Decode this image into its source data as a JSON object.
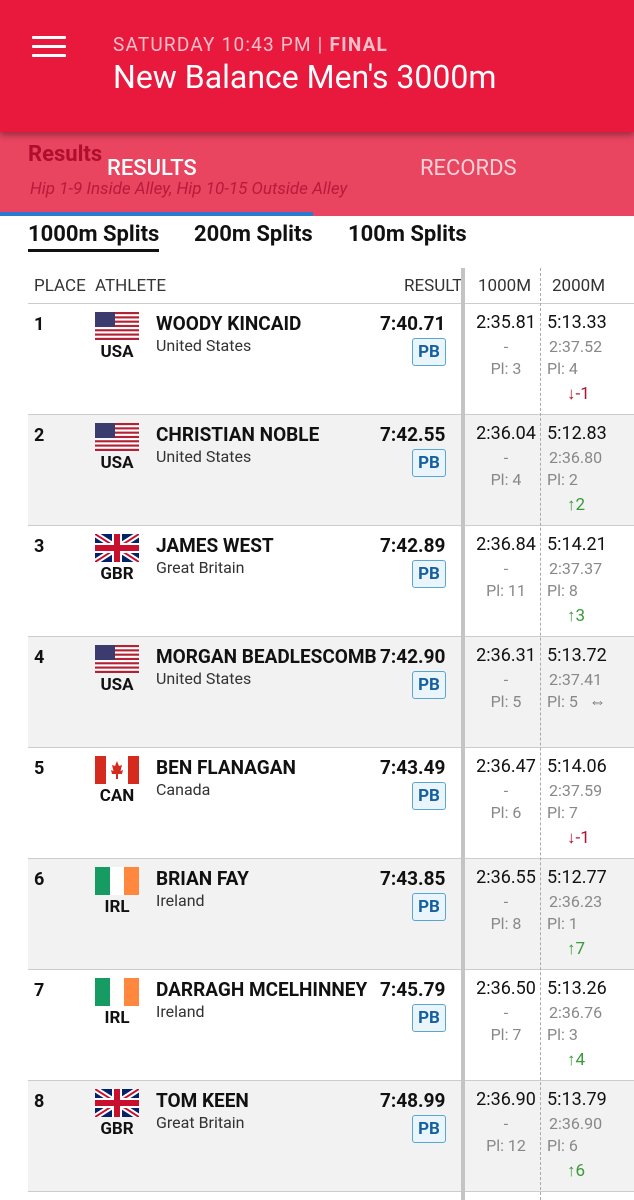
{
  "header": {
    "day_time": "SATURDAY 10:43 PM | ",
    "status": "FINAL",
    "title": "New Balance Men's 3000m"
  },
  "ghost": {
    "results": "Results",
    "note": "Hip 1-9 Inside Alley, Hip 10-15 Outside Alley"
  },
  "tabs": [
    "RESULTS",
    "RECORDS"
  ],
  "splits": [
    "1000m Splits",
    "200m Splits",
    "100m Splits"
  ],
  "columns": [
    "PLACE",
    "ATHLETE",
    "RESULT",
    "1000M",
    "2000M"
  ],
  "rows": [
    {
      "place": "1",
      "code": "USA",
      "name": "WOODY KINCAID",
      "country": "United States",
      "result": "7:40.71",
      "pb": "PB",
      "s1": "2:35.81",
      "s1d": "-",
      "s1p": "Pl: 3",
      "s2": "5:13.33",
      "s2d": "2:37.52",
      "s2p": "Pl: 4",
      "mv": "↓-1",
      "dir": "down"
    },
    {
      "place": "2",
      "code": "USA",
      "name": "CHRISTIAN NOBLE",
      "country": "United States",
      "result": "7:42.55",
      "pb": "PB",
      "s1": "2:36.04",
      "s1d": "-",
      "s1p": "Pl: 4",
      "s2": "5:12.83",
      "s2d": "2:36.80",
      "s2p": "Pl: 2",
      "mv": "↑2",
      "dir": "up"
    },
    {
      "place": "3",
      "code": "GBR",
      "name": "JAMES WEST",
      "country": "Great Britain",
      "result": "7:42.89",
      "pb": "PB",
      "s1": "2:36.84",
      "s1d": "-",
      "s1p": "Pl: 11",
      "s2": "5:14.21",
      "s2d": "2:37.37",
      "s2p": "Pl: 8",
      "mv": "↑3",
      "dir": "up"
    },
    {
      "place": "4",
      "code": "USA",
      "name": "MORGAN BEADLESCOMB",
      "country": "United States",
      "result": "7:42.90",
      "pb": "PB",
      "s1": "2:36.31",
      "s1d": "-",
      "s1p": "Pl: 5",
      "s2": "5:13.72",
      "s2d": "2:37.41",
      "s2p": "Pl: 5",
      "mv": "⇔",
      "dir": "same"
    },
    {
      "place": "5",
      "code": "CAN",
      "name": "BEN FLANAGAN",
      "country": "Canada",
      "result": "7:43.49",
      "pb": "PB",
      "s1": "2:36.47",
      "s1d": "-",
      "s1p": "Pl: 6",
      "s2": "5:14.06",
      "s2d": "2:37.59",
      "s2p": "Pl: 7",
      "mv": "↓-1",
      "dir": "down"
    },
    {
      "place": "6",
      "code": "IRL",
      "name": "BRIAN FAY",
      "country": "Ireland",
      "result": "7:43.85",
      "pb": "PB",
      "s1": "2:36.55",
      "s1d": "-",
      "s1p": "Pl: 8",
      "s2": "5:12.77",
      "s2d": "2:36.23",
      "s2p": "Pl: 1",
      "mv": "↑7",
      "dir": "up"
    },
    {
      "place": "7",
      "code": "IRL",
      "name": "DARRAGH MCELHINNEY",
      "country": "Ireland",
      "result": "7:45.79",
      "pb": "PB",
      "s1": "2:36.50",
      "s1d": "-",
      "s1p": "Pl: 7",
      "s2": "5:13.26",
      "s2d": "2:36.76",
      "s2p": "Pl: 3",
      "mv": "↑4",
      "dir": "up"
    },
    {
      "place": "8",
      "code": "GBR",
      "name": "TOM KEEN",
      "country": "Great Britain",
      "result": "7:48.99",
      "pb": "PB",
      "s1": "2:36.90",
      "s1d": "-",
      "s1p": "Pl: 12",
      "s2": "5:13.79",
      "s2d": "2:36.90",
      "s2p": "Pl: 6",
      "mv": "↑6",
      "dir": "up"
    }
  ]
}
